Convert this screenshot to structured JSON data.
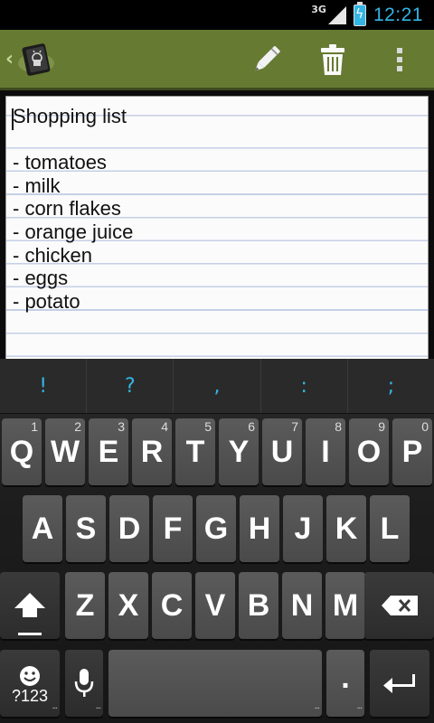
{
  "status_bar": {
    "network": "3G",
    "time": "12:21",
    "time_color": "#33b5e5"
  },
  "action_bar": {
    "background": "#667a32",
    "icons": {
      "up": "chevron-left-icon",
      "app": "notebook-android-icon",
      "edit": "pencil-icon",
      "delete": "trash-icon",
      "more": "overflow-menu-icon"
    }
  },
  "note": {
    "lines": [
      "Shopping list",
      "",
      "- tomatoes",
      "- milk",
      "- corn flakes",
      "- orange juice",
      "- chicken",
      "- eggs",
      "- potato"
    ]
  },
  "keyboard": {
    "suggestions": [
      "!",
      "?",
      ",",
      ":",
      ";"
    ],
    "row1": [
      {
        "label": "Q",
        "hint": "1"
      },
      {
        "label": "W",
        "hint": "2"
      },
      {
        "label": "E",
        "hint": "3"
      },
      {
        "label": "R",
        "hint": "4"
      },
      {
        "label": "T",
        "hint": "5"
      },
      {
        "label": "Y",
        "hint": "6"
      },
      {
        "label": "U",
        "hint": "7"
      },
      {
        "label": "I",
        "hint": "8"
      },
      {
        "label": "O",
        "hint": "9"
      },
      {
        "label": "P",
        "hint": "0"
      }
    ],
    "row2": [
      "A",
      "S",
      "D",
      "F",
      "G",
      "H",
      "J",
      "K",
      "L"
    ],
    "row3": [
      "Z",
      "X",
      "C",
      "V",
      "B",
      "N",
      "M"
    ],
    "symbols_label": "?123",
    "period_label": "."
  }
}
